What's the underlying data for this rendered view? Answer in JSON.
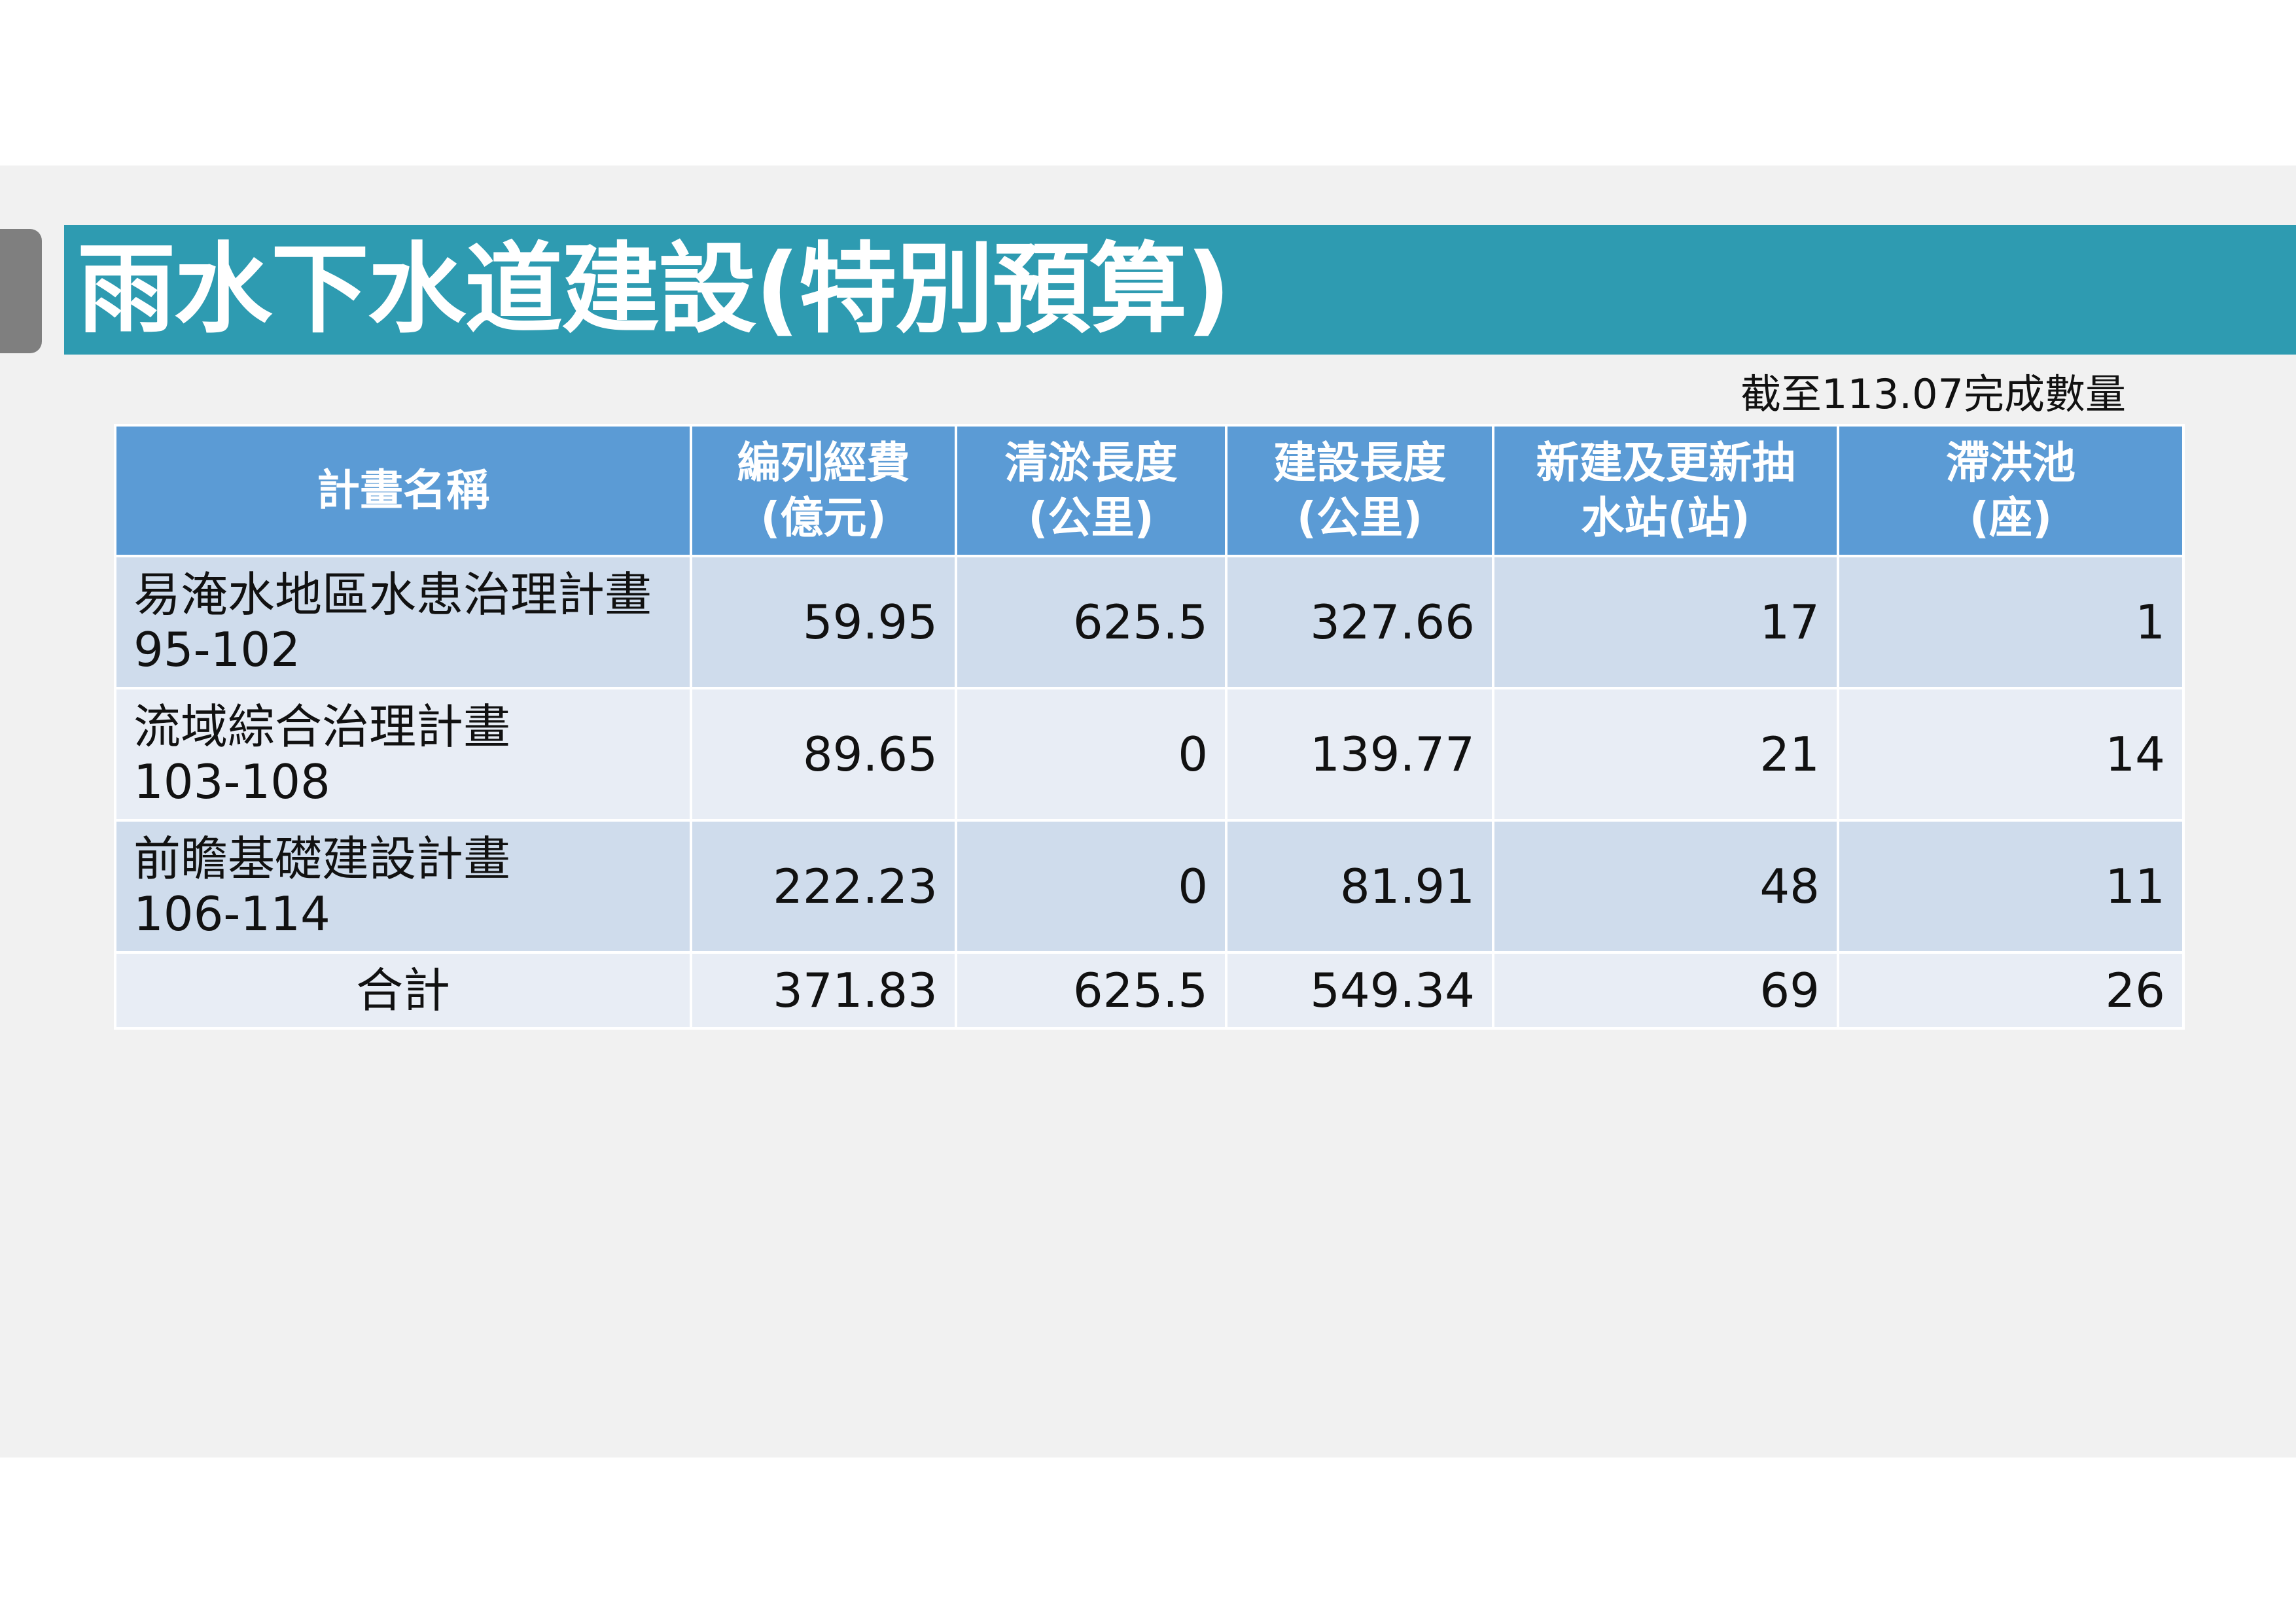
{
  "title": "雨水下水道建設(特別預算)",
  "note": "截至113.07完成數量",
  "table": {
    "headers": [
      "計畫名稱",
      "編列經費\n(億元)",
      "清淤長度\n(公里)",
      "建設長度\n(公里)",
      "新建及更新抽\n水站(站)",
      "滯洪池\n(座)"
    ],
    "rows": [
      [
        "易淹水地區水患治理計畫\n95-102",
        "59.95",
        "625.5",
        "327.66",
        "17",
        "1"
      ],
      [
        "流域綜合治理計畫\n103-108",
        "89.65",
        "0",
        "139.77",
        "21",
        "14"
      ],
      [
        "前瞻基礎建設計畫\n106-114",
        "222.23",
        "0",
        "81.91",
        "48",
        "11"
      ]
    ],
    "total": [
      "合計",
      "371.83",
      "625.5",
      "549.34",
      "69",
      "26"
    ]
  },
  "colors": {
    "title_bar": "#2e9bb1",
    "header": "#5b9bd5",
    "row_dark": "#cfdcec",
    "row_light": "#e8edf5"
  }
}
